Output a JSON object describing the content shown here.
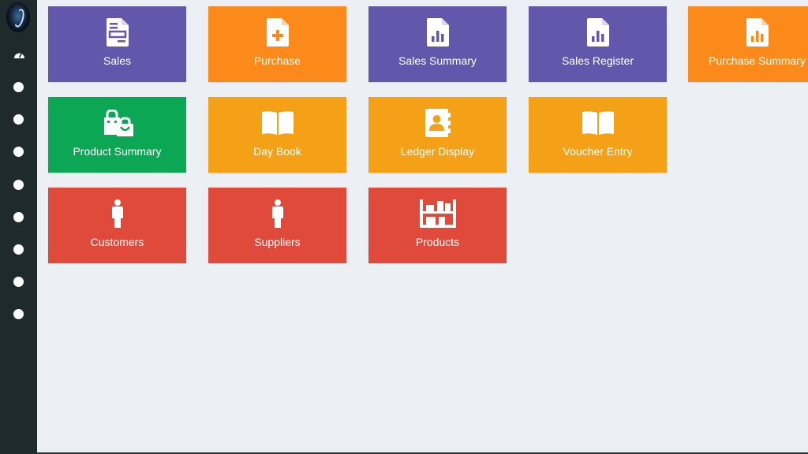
{
  "colors": {
    "sidebar": "#1f2a2c",
    "background": "#eceff4",
    "purple": "#6257ab",
    "orange": "#fb8a1b",
    "amber": "#f4a117",
    "green": "#0ca755",
    "red": "#e04a3b"
  },
  "sidebar": {
    "items": [
      {
        "icon": "dashboard-icon"
      },
      {
        "icon": "dot-icon"
      },
      {
        "icon": "dot-icon"
      },
      {
        "icon": "dot-icon"
      },
      {
        "icon": "dot-icon"
      },
      {
        "icon": "dot-icon"
      },
      {
        "icon": "dot-icon"
      },
      {
        "icon": "dot-icon"
      },
      {
        "icon": "dot-icon"
      },
      {
        "icon": "dot-icon"
      }
    ]
  },
  "tiles": [
    {
      "label": "Sales",
      "icon": "invoice-icon",
      "color": "purple"
    },
    {
      "label": "Purchase",
      "icon": "file-plus-icon",
      "color": "orange"
    },
    {
      "label": "Sales Summary",
      "icon": "file-chart-icon",
      "color": "purple"
    },
    {
      "label": "Sales Register",
      "icon": "file-chart-icon",
      "color": "purple"
    },
    {
      "label": "Purchase Summary",
      "icon": "file-chart-icon",
      "color": "orange"
    },
    {
      "label": "Product Summary",
      "icon": "shopping-bag-icon",
      "color": "green"
    },
    {
      "label": "Day Book",
      "icon": "open-book-icon",
      "color": "amber"
    },
    {
      "label": "Ledger Display",
      "icon": "contact-book-icon",
      "color": "amber"
    },
    {
      "label": "Voucher Entry",
      "icon": "open-book-icon",
      "color": "amber"
    },
    {
      "label": "Customers",
      "icon": "person-icon",
      "color": "red"
    },
    {
      "label": "Suppliers",
      "icon": "person-icon",
      "color": "red"
    },
    {
      "label": "Products",
      "icon": "warehouse-shelf-icon",
      "color": "red"
    }
  ]
}
